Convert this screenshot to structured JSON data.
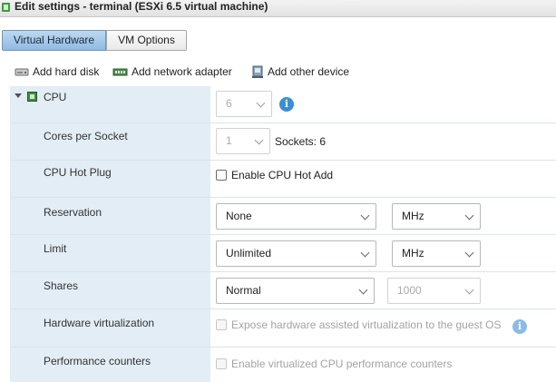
{
  "window": {
    "title": "Edit settings - terminal (ESXi 6.5 virtual machine)"
  },
  "tabs": [
    {
      "label": "Virtual Hardware",
      "active": true
    },
    {
      "label": "VM Options",
      "active": false
    }
  ],
  "toolbar": {
    "add_hard_disk": "Add hard disk",
    "add_network_adapter": "Add network adapter",
    "add_other_device": "Add other device"
  },
  "cpu": {
    "label": "CPU",
    "count": {
      "value": "6",
      "disabled": true
    },
    "cores_per_socket": {
      "label": "Cores per Socket",
      "value": "1",
      "disabled": true,
      "sockets_text": "Sockets: 6"
    },
    "hot_plug": {
      "label": "CPU Hot Plug",
      "checkbox_label": "Enable CPU Hot Add",
      "checked": false
    },
    "reservation": {
      "label": "Reservation",
      "value": "None",
      "unit": "MHz"
    },
    "limit": {
      "label": "Limit",
      "value": "Unlimited",
      "unit": "MHz"
    },
    "shares": {
      "label": "Shares",
      "value": "Normal",
      "amount": "1000",
      "amount_disabled": true
    },
    "hw_virtualization": {
      "label": "Hardware virtualization",
      "checkbox_label": "Expose hardware assisted virtualization to the guest OS",
      "checked": false,
      "disabled": true
    },
    "perf_counters": {
      "label": "Performance counters",
      "checkbox_label": "Enable virtualized CPU performance counters",
      "checked": false,
      "disabled": true
    }
  },
  "colors": {
    "accent": "#3a8ed6",
    "label_column": "#e2edf5",
    "active_tab": "#8fbbe2"
  }
}
